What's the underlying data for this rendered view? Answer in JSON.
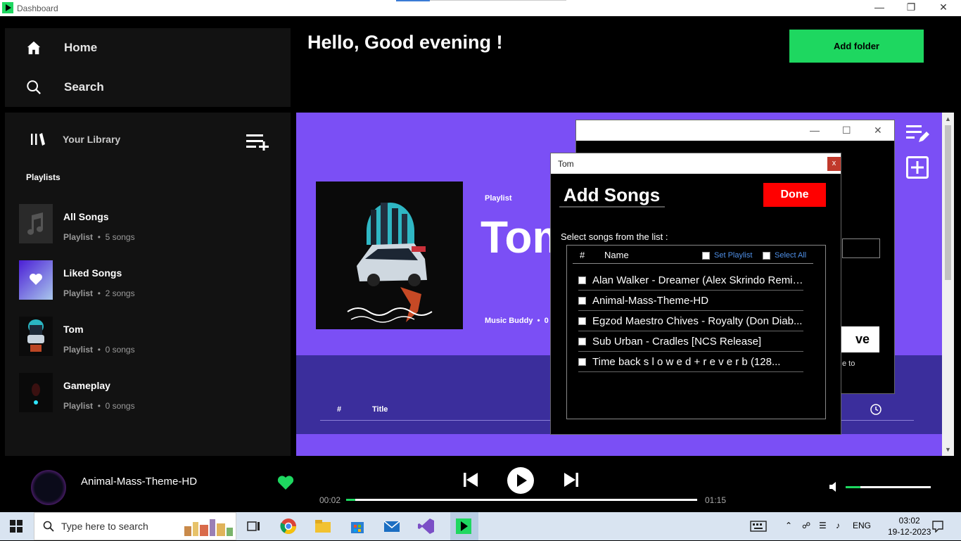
{
  "window": {
    "title": "Dashboard"
  },
  "nav": {
    "home": "Home",
    "search": "Search"
  },
  "library": {
    "title": "Your Library",
    "playlists_label": "Playlists",
    "items": [
      {
        "name": "All Songs",
        "type": "Playlist",
        "count": "5 songs"
      },
      {
        "name": "Liked Songs",
        "type": "Playlist",
        "count": "2 songs"
      },
      {
        "name": "Tom",
        "type": "Playlist",
        "count": "0 songs"
      },
      {
        "name": "Gameplay",
        "type": "Playlist",
        "count": "0 songs"
      }
    ]
  },
  "header": {
    "greeting": "Hello, Good evening !",
    "add_folder": "Add folder"
  },
  "playlist_view": {
    "type": "Playlist",
    "title": "Tom",
    "owner": "Music Buddy",
    "owner_sep": "•",
    "owner_suffix": "0",
    "columns": {
      "index": "#",
      "title": "Title"
    }
  },
  "back_dialog": {
    "save_label": "ve",
    "note": "e to"
  },
  "add_songs_dialog": {
    "window_title": "Tom",
    "close_label": "x",
    "heading": "Add Songs",
    "done_label": "Done",
    "select_label": "Select songs from the list :",
    "list_headers": {
      "index": "#",
      "name": "Name",
      "set_playlist": "Set Playlist",
      "select_all": "Select All"
    },
    "songs": [
      "Alan Walker - Dreamer (Alex Skrindo Remix)...",
      "Animal-Mass-Theme-HD",
      "Egzod  Maestro Chives - Royalty (Don Diab...",
      "Sub Urban - Cradles [NCS Release]",
      "Time back   s l o w e d + r e v e r b (128..."
    ]
  },
  "player": {
    "now_playing": "Animal-Mass-Theme-HD",
    "current_time": "00:02",
    "duration": "01:15",
    "progress_fraction": 0.026,
    "volume_fraction": 0.17
  },
  "taskbar": {
    "search_placeholder": "Type here to search",
    "language": "ENG",
    "time": "03:02",
    "date": "19-12-2023"
  },
  "colors": {
    "accent": "#1ed760",
    "hero": "#7b4ff5",
    "songs_area": "#3b2e9c",
    "done": "#ff0000"
  }
}
